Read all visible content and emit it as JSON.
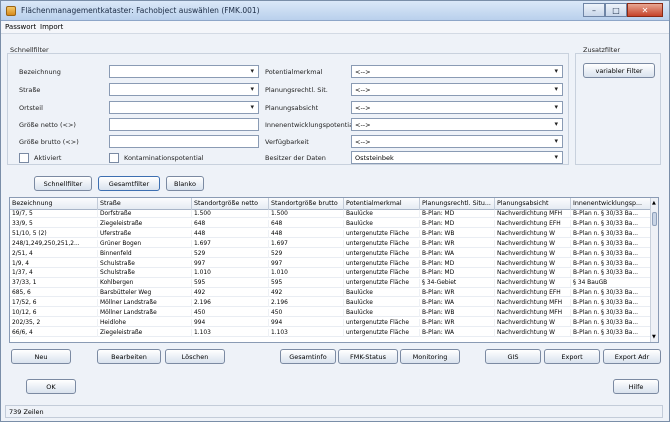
{
  "window": {
    "title": "Flächenmanagementkataster: Fachobject auswählen (FMK.001)"
  },
  "menu": [
    "Passwort",
    "Import"
  ],
  "filter": {
    "group_label": "Schnellfilter",
    "zusatz_label": "Zusatzfilter",
    "variable_button": "variabler Filter",
    "left_fields": [
      {
        "label": "Bezeichnung",
        "type": "combo",
        "value": ""
      },
      {
        "label": "Straße",
        "type": "combo",
        "value": ""
      },
      {
        "label": "Ortsteil",
        "type": "combo",
        "value": ""
      },
      {
        "label": "Größe netto (<>)",
        "type": "text",
        "value": ""
      },
      {
        "label": "Größe brutto (<>)",
        "type": "text",
        "value": ""
      }
    ],
    "right_fields": [
      {
        "label": "Potentialmerkmal",
        "value": "<-->"
      },
      {
        "label": "Planungsrechtl. Sit.",
        "value": "<-->"
      },
      {
        "label": "Planungsabsicht",
        "value": "<-->"
      },
      {
        "label": "Innenentwicklungspotential",
        "value": "<-->"
      },
      {
        "label": "Verfügbarkeit",
        "value": "<-->"
      },
      {
        "label": "Besitzer der Daten",
        "value": "Oststeinbek"
      }
    ],
    "aktiviert": "Aktiviert",
    "kontamination": "Kontaminationspotential"
  },
  "tabs": [
    "Schnellfilter",
    "Gesamtfilter",
    "Blanko"
  ],
  "table": {
    "columns": [
      "Bezeichnung",
      "Straße",
      "Standortgröße netto",
      "Standortgröße brutto",
      "Potentialmerkmal",
      "Planungsrechtl. Situ...",
      "Planungsabsicht",
      "Innenentwicklungsp..."
    ],
    "rows": [
      [
        "19/7, 5",
        "Dorfstraße",
        "1.500",
        "1.500",
        "Baulücke",
        "B-Plan: MD",
        "Nachverdichtung MFH",
        "B-Plan n. § 30/33 Ba..."
      ],
      [
        "33/9, 5",
        "Ziegeleistraße",
        "648",
        "648",
        "Baulücke",
        "B-Plan: MD",
        "Nachverdichtung EFH",
        "B-Plan n. § 30/33 Ba..."
      ],
      [
        "51/10, 5 (2)",
        "Uferstraße",
        "448",
        "448",
        "untergenutzte Fläche",
        "B-Plan: WB",
        "Nachverdichtung W",
        "B-Plan n. § 30/33 Ba..."
      ],
      [
        "248/1,249,250,251,2...",
        "Grüner Bogen",
        "1.697",
        "1.697",
        "untergenutzte Fläche",
        "B-Plan: WR",
        "Nachverdichtung W",
        "B-Plan n. § 30/33 Ba..."
      ],
      [
        "2/51, 4",
        "Binnenfeld",
        "529",
        "529",
        "untergenutzte Fläche",
        "B-Plan: WA",
        "Nachverdichtung W",
        "B-Plan n. § 30/33 Ba..."
      ],
      [
        "1/9, 4",
        "Schulstraße",
        "997",
        "997",
        "untergenutzte Fläche",
        "B-Plan: MD",
        "Nachverdichtung W",
        "B-Plan n. § 30/33 Ba..."
      ],
      [
        "1/37, 4",
        "Schulstraße",
        "1.010",
        "1.010",
        "untergenutzte Fläche",
        "B-Plan: MD",
        "Nachverdichtung W",
        "B-Plan n. § 30/33 Ba..."
      ],
      [
        "37/33, 1",
        "Kohlbergen",
        "595",
        "595",
        "untergenutzte Fläche",
        "§ 34-Gebiet",
        "Nachverdichtung W",
        "§ 34 BauGB"
      ],
      [
        "685, 6",
        "Barsbütteler Weg",
        "492",
        "492",
        "Baulücke",
        "B-Plan: WR",
        "Nachverdichtung EFH",
        "B-Plan n. § 30/33 Ba..."
      ],
      [
        "17/52, 6",
        "Möllner Landstraße",
        "2.196",
        "2.196",
        "Baulücke",
        "B-Plan: WA",
        "Nachverdichtung MFH",
        "B-Plan n. § 30/33 Ba..."
      ],
      [
        "10/12, 6",
        "Möllner Landstraße",
        "450",
        "450",
        "Baulücke",
        "B-Plan: WB",
        "Nachverdichtung MFH",
        "B-Plan n. § 30/33 Ba..."
      ],
      [
        "202/35, 2",
        "Heidlohe",
        "994",
        "994",
        "untergenutzte Fläche",
        "B-Plan: WR",
        "Nachverdichtung W",
        "B-Plan n. § 30/33 Ba..."
      ],
      [
        "66/6, 4",
        "Ziegeleistraße",
        "1.103",
        "1.103",
        "untergenutzte Fläche",
        "B-Plan: WA",
        "Nachverdichtung W",
        "B-Plan n. § 30/33 Ba..."
      ]
    ]
  },
  "actions": {
    "neu": "Neu",
    "bearbeiten": "Bearbeiten",
    "loeschen": "Löschen",
    "gesamtinfo": "Gesamtinfo",
    "fmk_status": "FMK-Status",
    "monitoring": "Monitoring",
    "gis": "GIS",
    "export": "Export",
    "export_adr": "Export Adr",
    "ok": "OK",
    "hilfe": "Hilfe"
  },
  "status": "739 Zeilen"
}
